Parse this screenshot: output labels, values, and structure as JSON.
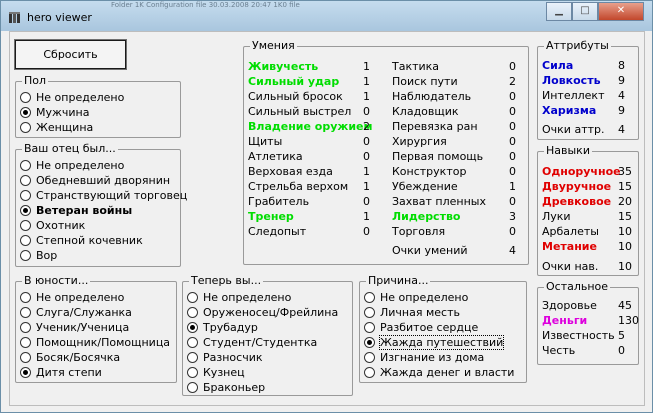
{
  "window": {
    "title": "hero viewer",
    "background_text": "Folder     1K        Configuration file      30.03.2008 20:47       1K0 file"
  },
  "buttons": {
    "reset": "Сбросить"
  },
  "gender": {
    "legend": "Пол",
    "options": [
      {
        "label": "Не определено",
        "selected": false
      },
      {
        "label": "Мужчина",
        "selected": true
      },
      {
        "label": "Женщина",
        "selected": false
      }
    ]
  },
  "father": {
    "legend": "Ваш отец был...",
    "options": [
      {
        "label": "Не определено",
        "selected": false
      },
      {
        "label": "Обедневший дворянин",
        "selected": false
      },
      {
        "label": "Странствующий торговец",
        "selected": false
      },
      {
        "label": "Ветеран войны",
        "selected": true
      },
      {
        "label": "Охотник",
        "selected": false
      },
      {
        "label": "Степной кочевник",
        "selected": false
      },
      {
        "label": "Вор",
        "selected": false
      }
    ]
  },
  "youth": {
    "legend": "В юности...",
    "options": [
      {
        "label": "Не определено",
        "selected": false
      },
      {
        "label": "Слуга/Служанка",
        "selected": false
      },
      {
        "label": "Ученик/Ученица",
        "selected": false
      },
      {
        "label": "Помощник/Помощница",
        "selected": false
      },
      {
        "label": "Босяк/Босячка",
        "selected": false
      },
      {
        "label": "Дитя степи",
        "selected": true
      }
    ]
  },
  "now": {
    "legend": "Теперь вы...",
    "options": [
      {
        "label": "Не определено",
        "selected": false
      },
      {
        "label": "Оруженосец/Фрейлина",
        "selected": false
      },
      {
        "label": "Трубадур",
        "selected": true
      },
      {
        "label": "Студент/Студентка",
        "selected": false
      },
      {
        "label": "Разносчик",
        "selected": false
      },
      {
        "label": "Кузнец",
        "selected": false
      },
      {
        "label": "Браконьер",
        "selected": false
      }
    ]
  },
  "reason": {
    "legend": "Причина...",
    "options": [
      {
        "label": "Не определено",
        "selected": false
      },
      {
        "label": "Личная месть",
        "selected": false
      },
      {
        "label": "Разбитое сердце",
        "selected": false
      },
      {
        "label": "Жажда путешествий",
        "selected": true
      },
      {
        "label": "Изгнание из дома",
        "selected": false
      },
      {
        "label": "Жажда денег и власти",
        "selected": false
      }
    ]
  },
  "skills": {
    "legend": "Умения",
    "left": [
      {
        "label": "Живучесть",
        "value": "1",
        "color": "green"
      },
      {
        "label": "Сильный удар",
        "value": "1",
        "color": "green"
      },
      {
        "label": "Сильный бросок",
        "value": "1",
        "color": ""
      },
      {
        "label": "Сильный выстрел",
        "value": "0",
        "color": ""
      },
      {
        "label": "Владение оружием",
        "value": "2",
        "color": "green"
      },
      {
        "label": "Щиты",
        "value": "0",
        "color": ""
      },
      {
        "label": "Атлетика",
        "value": "0",
        "color": ""
      },
      {
        "label": "Верховая езда",
        "value": "1",
        "color": ""
      },
      {
        "label": "Стрельба верхом",
        "value": "1",
        "color": ""
      },
      {
        "label": "Грабитель",
        "value": "0",
        "color": ""
      },
      {
        "label": "Тренер",
        "value": "1",
        "color": "green"
      },
      {
        "label": "Следопыт",
        "value": "0",
        "color": ""
      }
    ],
    "right": [
      {
        "label": "Тактика",
        "value": "0",
        "color": ""
      },
      {
        "label": "Поиск пути",
        "value": "2",
        "color": ""
      },
      {
        "label": "Наблюдатель",
        "value": "0",
        "color": ""
      },
      {
        "label": "Кладовщик",
        "value": "0",
        "color": ""
      },
      {
        "label": "Перевязка ран",
        "value": "0",
        "color": ""
      },
      {
        "label": "Хирургия",
        "value": "0",
        "color": ""
      },
      {
        "label": "Первая помощь",
        "value": "0",
        "color": ""
      },
      {
        "label": "Конструктор",
        "value": "0",
        "color": ""
      },
      {
        "label": "Убеждение",
        "value": "1",
        "color": ""
      },
      {
        "label": "Захват пленных",
        "value": "0",
        "color": ""
      },
      {
        "label": "Лидерство",
        "value": "3",
        "color": "green"
      },
      {
        "label": "Торговля",
        "value": "0",
        "color": ""
      }
    ],
    "points_label": "Очки умений",
    "points_value": "4"
  },
  "attributes": {
    "legend": "Аттрибуты",
    "items": [
      {
        "label": "Сила",
        "value": "8",
        "color": "blue"
      },
      {
        "label": "Ловкость",
        "value": "9",
        "color": "blue"
      },
      {
        "label": "Интеллект",
        "value": "4",
        "color": ""
      },
      {
        "label": "Харизма",
        "value": "9",
        "color": "blue"
      }
    ],
    "points_label": "Очки аттр.",
    "points_value": "4"
  },
  "proficiencies": {
    "legend": "Навыки",
    "items": [
      {
        "label": "Одноручное",
        "value": "35",
        "color": "red"
      },
      {
        "label": "Двуручное",
        "value": "15",
        "color": "red"
      },
      {
        "label": "Древковое",
        "value": "20",
        "color": "red"
      },
      {
        "label": "Луки",
        "value": "15",
        "color": ""
      },
      {
        "label": "Арбалеты",
        "value": "10",
        "color": ""
      },
      {
        "label": "Метание",
        "value": "10",
        "color": "red"
      }
    ],
    "points_label": "Очки нав.",
    "points_value": "10"
  },
  "other": {
    "legend": "Остальное",
    "items": [
      {
        "label": "Здоровье",
        "value": "45",
        "color": ""
      },
      {
        "label": "Деньги",
        "value": "130",
        "color": "magenta"
      },
      {
        "label": "Известность",
        "value": "5",
        "color": ""
      },
      {
        "label": "Честь",
        "value": "0",
        "color": ""
      }
    ]
  }
}
